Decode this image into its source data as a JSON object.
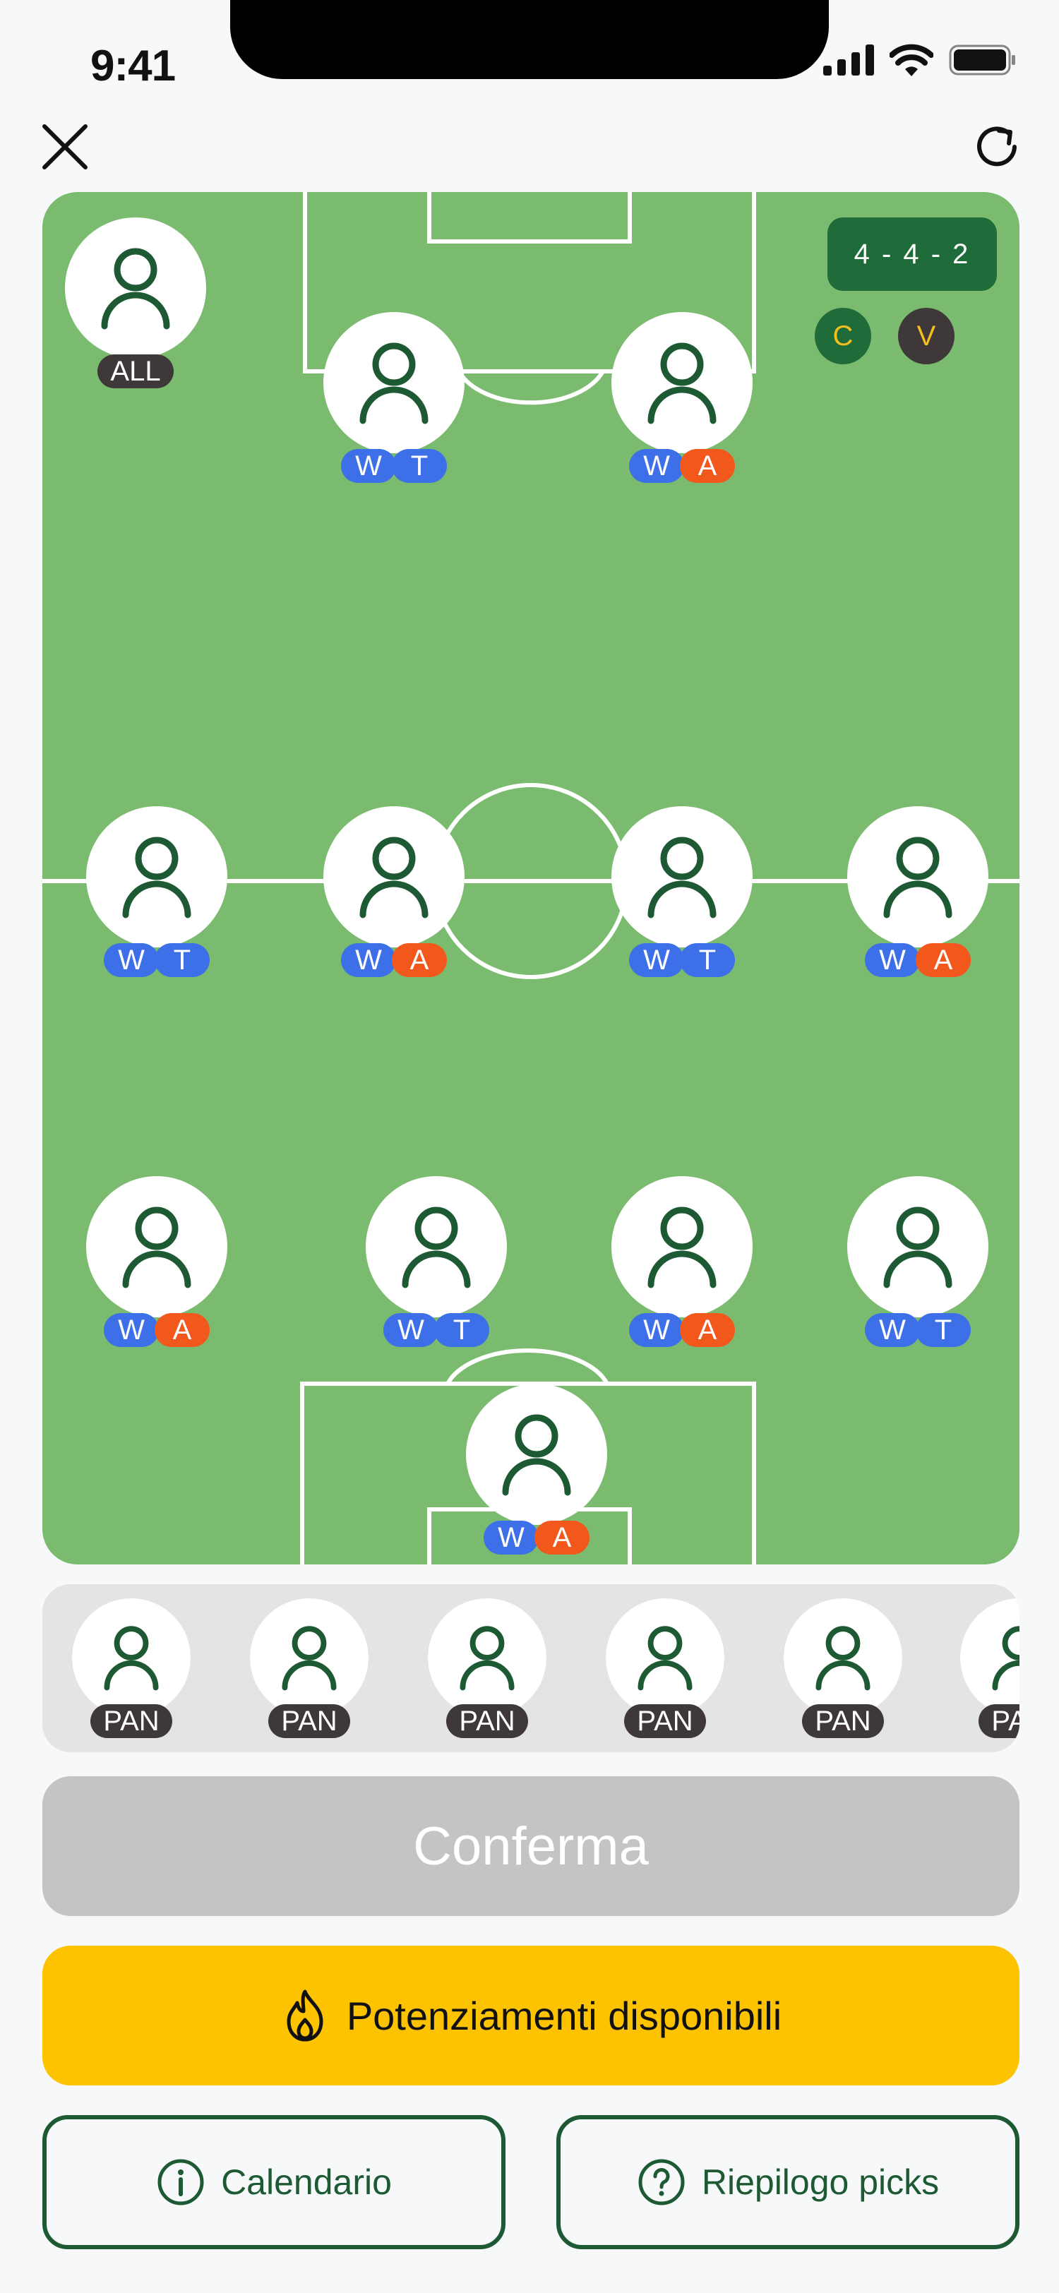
{
  "status_bar": {
    "time": "9:41"
  },
  "top_bar": {
    "close_icon": "close-icon",
    "refresh_icon": "refresh-icon"
  },
  "pitch": {
    "formation": "4 - 4 - 2",
    "captain": "C",
    "vice": "V",
    "coach_tag": "ALL",
    "players": [
      {
        "tags": [
          "W",
          "T"
        ]
      },
      {
        "tags": [
          "W",
          "A"
        ]
      },
      {
        "tags": [
          "W",
          "T"
        ]
      },
      {
        "tags": [
          "W",
          "A"
        ]
      },
      {
        "tags": [
          "W",
          "T"
        ]
      },
      {
        "tags": [
          "W",
          "A"
        ]
      },
      {
        "tags": [
          "W",
          "A"
        ]
      },
      {
        "tags": [
          "W",
          "T"
        ]
      },
      {
        "tags": [
          "W",
          "A"
        ]
      },
      {
        "tags": [
          "W",
          "T"
        ]
      },
      {
        "tags": [
          "W",
          "A"
        ]
      }
    ]
  },
  "bench": {
    "tag": "PAN",
    "count": 6
  },
  "buttons": {
    "confirm": "Conferma",
    "boosts": "Potenziamenti disponibili",
    "calendar": "Calendario",
    "picks_summary": "Riepilogo picks"
  },
  "colors": {
    "pitch": "#7BBB6F",
    "dark_green": "#1D5A33",
    "tag_blue": "#3C6FE8",
    "tag_orange": "#F2571C",
    "boost_yellow": "#FDC300"
  }
}
